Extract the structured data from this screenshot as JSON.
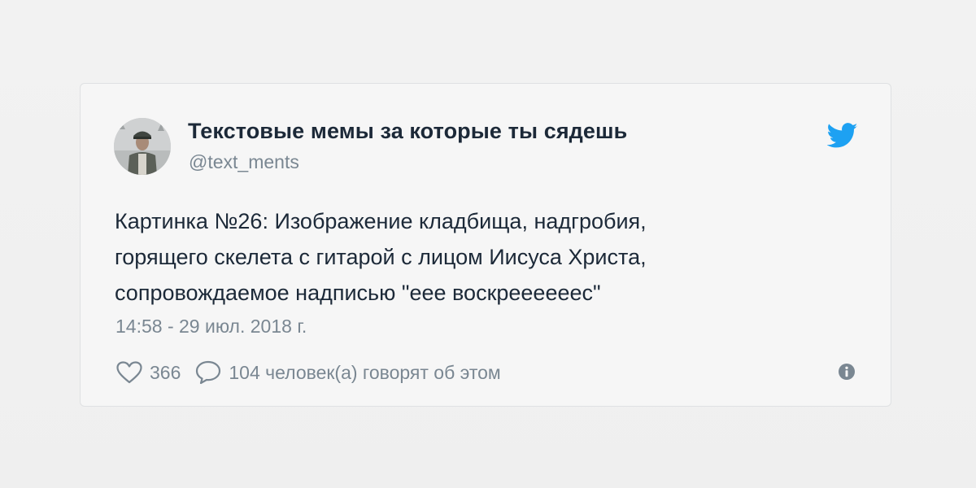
{
  "tweet": {
    "author": {
      "display_name": "Текстовые мемы за которые ты сядешь",
      "handle": "@text_ments",
      "avatar_icon": "profile-photo"
    },
    "text_lines": [
      "Картинка №26: Изображение кладбища, надгробия,",
      "горящего скелета с гитарой с лицом Иисуса Христа,",
      "сопровождаемое надписью \"еее воскрееееeeс\""
    ],
    "timestamp": "14:58 - 29 июл. 2018 г.",
    "likes": "366",
    "replies_text": "104 человек(а) говорят об этом"
  },
  "icons": {
    "brand": "twitter-bird-icon",
    "like": "heart-icon",
    "reply": "speech-bubble-icon",
    "info": "info-icon"
  },
  "colors": {
    "twitter_blue": "#1da1f2",
    "text_primary": "#1c2938",
    "text_secondary": "#7a8792",
    "card_background": "#f6f6f6",
    "card_border": "#dfe1e3"
  }
}
